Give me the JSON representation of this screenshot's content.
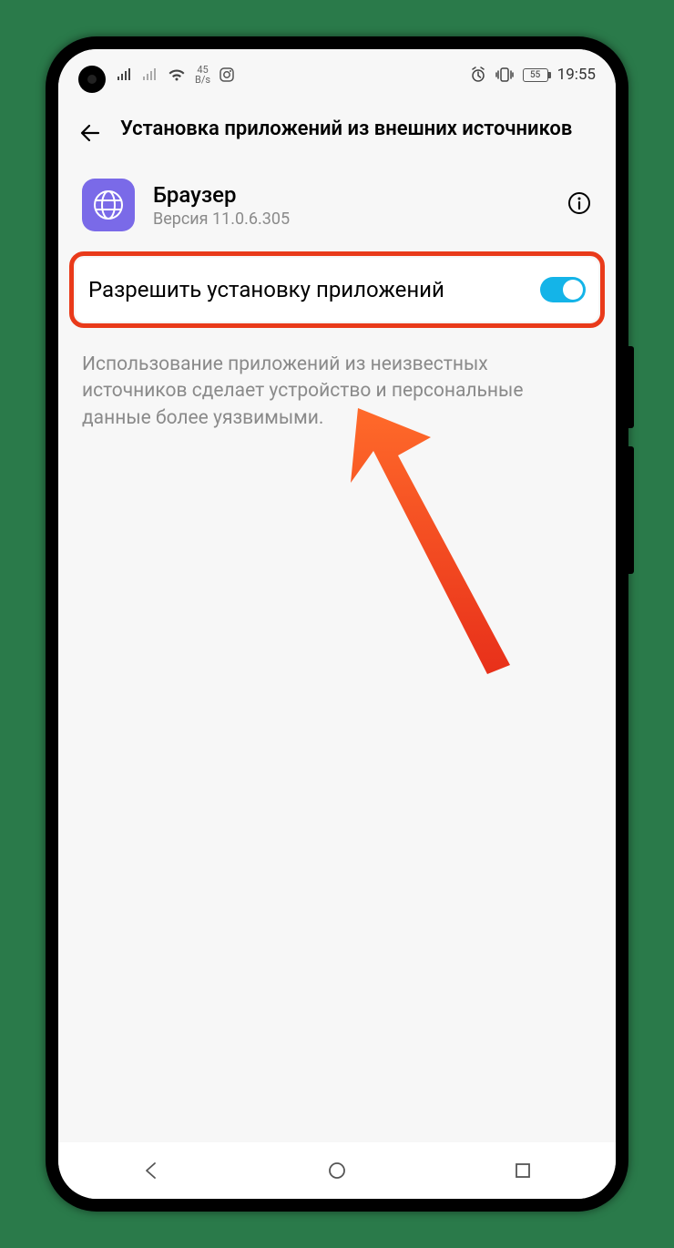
{
  "status": {
    "net_speed_top": "45",
    "net_speed_bottom": "B/s",
    "battery_text": "55",
    "time": "19:55"
  },
  "header": {
    "title": "Установка приложений из внешних источников"
  },
  "app": {
    "name": "Браузер",
    "version": "Версия 11.0.6.305"
  },
  "toggle": {
    "label": "Разрешить установку приложений",
    "enabled": true
  },
  "description": "Использование приложений из неизвестных источников сделает устройство и персональные данные более уязвимыми."
}
